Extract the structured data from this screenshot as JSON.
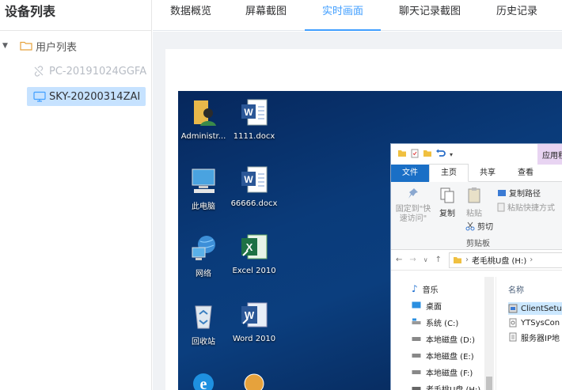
{
  "sidebar": {
    "title": "设备列表",
    "root": {
      "label": "用户列表"
    },
    "devices": [
      {
        "name": "PC-20191024GGFA",
        "status": "offline"
      },
      {
        "name": "SKY-20200314ZAI",
        "status": "online"
      }
    ]
  },
  "tabs": [
    {
      "label": "数据概览"
    },
    {
      "label": "屏幕截图"
    },
    {
      "label": "实时画面"
    },
    {
      "label": "聊天记录截图"
    },
    {
      "label": "历史记录"
    }
  ],
  "active_tab": "实时画面",
  "colors": {
    "accent": "#409eff",
    "selected_bg": "#c6e2ff",
    "offline_text": "#b7bcc4"
  },
  "remote_screen": {
    "desktop_icons": [
      {
        "label": "Administr...",
        "icon": "user-folder-icon"
      },
      {
        "label": "1111.docx",
        "icon": "word-doc-icon"
      },
      {
        "label": "此电脑",
        "icon": "computer-icon"
      },
      {
        "label": "66666.docx",
        "icon": "word-doc-icon"
      },
      {
        "label": "网络",
        "icon": "network-icon"
      },
      {
        "label": "Excel 2010",
        "icon": "excel-icon"
      },
      {
        "label": "回收站",
        "icon": "recycle-bin-icon"
      },
      {
        "label": "Word 2010",
        "icon": "word-app-icon"
      }
    ],
    "explorer": {
      "context_tab": "应用程",
      "ribbon_tabs": [
        "文件",
        "主页",
        "共享",
        "查看"
      ],
      "ribbon": {
        "pin": "固定到\"快速访问\"",
        "copy": "复制",
        "paste": "粘贴",
        "copy_path": "复制路径",
        "paste_shortcut": "粘贴快捷方式",
        "cut": "剪切",
        "group": "剪贴板"
      },
      "address": "老毛桃U盘 (H:)",
      "nav_items": [
        {
          "label": "音乐",
          "icon": "music-icon"
        },
        {
          "label": "桌面",
          "icon": "desktop-icon"
        },
        {
          "label": "系统 (C:)",
          "icon": "system-drive-icon"
        },
        {
          "label": "本地磁盘 (D:)",
          "icon": "drive-icon"
        },
        {
          "label": "本地磁盘 (E:)",
          "icon": "drive-icon"
        },
        {
          "label": "本地磁盘 (F:)",
          "icon": "drive-icon"
        },
        {
          "label": "老毛桃U盘 (H:)",
          "icon": "usb-drive-icon"
        }
      ],
      "column_name": "名称",
      "files": [
        {
          "label": "ClientSetu",
          "selected": true
        },
        {
          "label": "YTSysCon",
          "selected": false
        },
        {
          "label": "服务器IP地",
          "selected": false
        }
      ]
    }
  }
}
